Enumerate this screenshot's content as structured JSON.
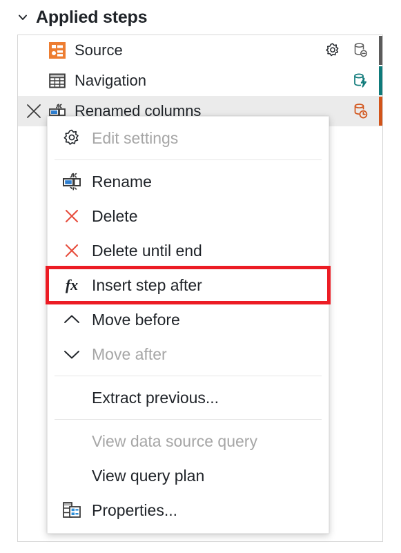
{
  "header": {
    "title": "Applied steps",
    "chevron_icon": "chevron-down-icon",
    "expanded": true
  },
  "colors": {
    "accent_orange": "#ED7D31",
    "highlight_red": "#EC1C24",
    "folding_teal": "#0F7A7A",
    "not_folding_orange": "#D2541A",
    "not_supported_gray": "#5B5B5B",
    "disabled_text": "#A6A6A6",
    "text": "#1F2328",
    "selected_row_bg": "#EBEBEB",
    "panel_border": "#D6D6D6"
  },
  "applied_steps": {
    "steps": [
      {
        "label": "Source",
        "icon": "source-step-icon",
        "selected": false,
        "has_gear": true,
        "has_delete": false,
        "fold_indicator": "database-minus-icon",
        "fold_state": "not-supported",
        "fold_color": "#5B5B5B"
      },
      {
        "label": "Navigation",
        "icon": "table-step-icon",
        "selected": false,
        "has_gear": false,
        "has_delete": false,
        "fold_indicator": "database-lightning-icon",
        "fold_state": "folding",
        "fold_color": "#0F7A7A"
      },
      {
        "label": "Renamed columns",
        "icon": "rename-columns-step-icon",
        "selected": true,
        "has_gear": false,
        "has_delete": true,
        "delete_icon": "close-x-icon",
        "fold_indicator": "database-clock-icon",
        "fold_state": "not-folding",
        "fold_color": "#D2541A"
      }
    ]
  },
  "context_menu": {
    "items": [
      {
        "type": "item",
        "label": "Edit settings",
        "icon": "gear-icon",
        "disabled": true,
        "highlighted": false
      },
      {
        "type": "separator"
      },
      {
        "type": "item",
        "label": "Rename",
        "icon": "rename-icon",
        "disabled": false,
        "highlighted": false
      },
      {
        "type": "item",
        "label": "Delete",
        "icon": "delete-x-icon",
        "disabled": false,
        "highlighted": false
      },
      {
        "type": "item",
        "label": "Delete until end",
        "icon": "delete-x-icon",
        "disabled": false,
        "highlighted": false
      },
      {
        "type": "item",
        "label": "Insert step after",
        "icon": "fx-icon",
        "disabled": false,
        "highlighted": true
      },
      {
        "type": "item",
        "label": "Move before",
        "icon": "chevron-up-icon",
        "disabled": false,
        "highlighted": false
      },
      {
        "type": "item",
        "label": "Move after",
        "icon": "chevron-down-icon",
        "disabled": true,
        "highlighted": false
      },
      {
        "type": "separator"
      },
      {
        "type": "item",
        "label": "Extract previous...",
        "icon": "none",
        "disabled": false,
        "highlighted": false
      },
      {
        "type": "separator"
      },
      {
        "type": "item",
        "label": "View data source query",
        "icon": "none",
        "disabled": true,
        "highlighted": false
      },
      {
        "type": "item",
        "label": "View query plan",
        "icon": "none",
        "disabled": false,
        "highlighted": false
      },
      {
        "type": "item",
        "label": "Properties...",
        "icon": "properties-icon",
        "disabled": false,
        "highlighted": false
      }
    ]
  }
}
